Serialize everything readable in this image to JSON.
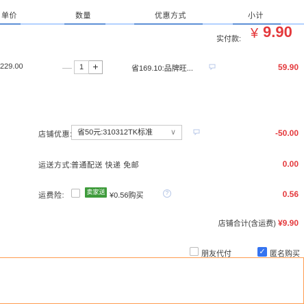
{
  "header": {
    "unit_price": "单价",
    "quantity": "数量",
    "promotion": "优惠方式",
    "subtotal": "小计"
  },
  "item": {
    "unit_price": "229.00",
    "minus": "—",
    "quantity": "1",
    "plus": "+",
    "promotion": "省169.10:品牌旺...",
    "subtotal": "59.90"
  },
  "shop_coupon": {
    "label": "店铺优惠:",
    "selected": "省50元:310312TK标准",
    "chevron": "∨",
    "amount": "-50.00"
  },
  "shipping": {
    "label": "运送方式:",
    "method": "普通配送 快递 免邮",
    "amount": "0.00"
  },
  "insurance": {
    "label": "运费险:",
    "badge": "卖家送",
    "text": "¥0.56购买",
    "help": "?",
    "amount": "0.56"
  },
  "shop_total": {
    "label": "店铺合计(含运费)",
    "amount": "¥9.90"
  },
  "options": {
    "pay_for_friend": "朋友代付",
    "anonymous_check": "✓",
    "anonymous": "匿名购买"
  },
  "payment": {
    "label": "实付款:",
    "symbol": "¥",
    "amount": "9.90"
  },
  "colors": {
    "price_red": "#e4393c",
    "accent_blue": "#3574f0",
    "insurance_green": "#3e9b3b",
    "pay_border": "#ff9a4d"
  }
}
